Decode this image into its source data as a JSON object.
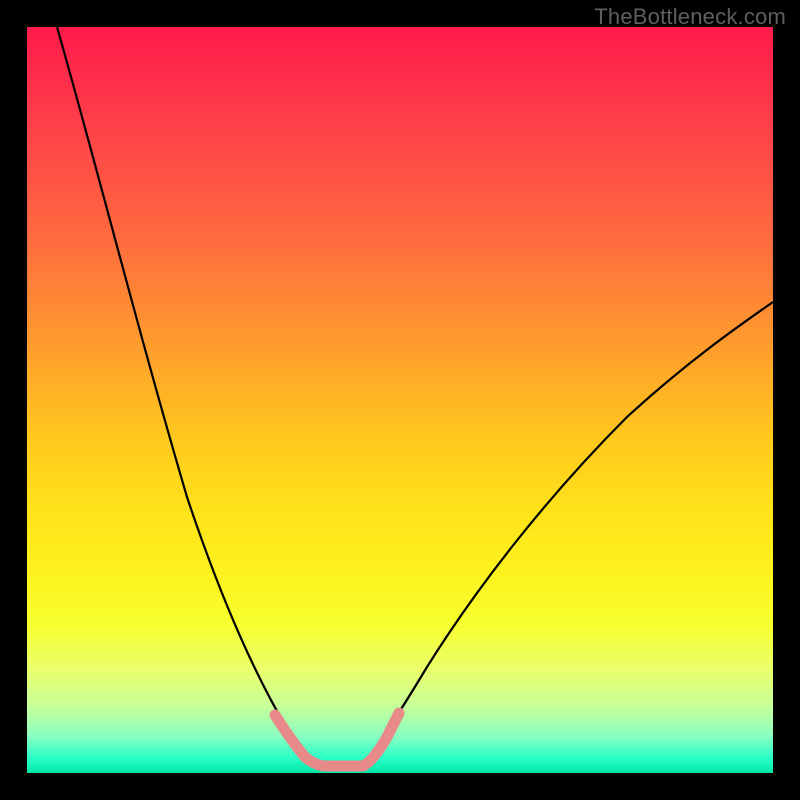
{
  "watermark": "TheBottleneck.com",
  "chart_data": {
    "type": "line",
    "title": "",
    "xlabel": "",
    "ylabel": "",
    "xlim": [
      0,
      100
    ],
    "ylim": [
      0,
      100
    ],
    "gradient_colors": {
      "top": "#ff1a4a",
      "mid": "#ffe31a",
      "bottom": "#00e6a8"
    },
    "series": [
      {
        "name": "left-curve",
        "x": [
          4,
          8,
          12,
          16,
          20,
          24,
          28,
          31,
          33,
          34.5,
          36,
          37.5
        ],
        "values": [
          100,
          79,
          61,
          46,
          33,
          22,
          13,
          7,
          4,
          2.5,
          1.5,
          1
        ]
      },
      {
        "name": "right-curve",
        "x": [
          44,
          46,
          48,
          52,
          56,
          62,
          70,
          78,
          86,
          94,
          100
        ],
        "values": [
          1,
          2,
          4,
          8,
          13,
          20,
          29,
          38,
          47,
          55,
          61
        ]
      },
      {
        "name": "floor-segment",
        "x": [
          37.5,
          44
        ],
        "values": [
          1,
          1
        ]
      },
      {
        "name": "pink-marker-left",
        "x": [
          32,
          33,
          34,
          35,
          36,
          37,
          38
        ],
        "values": [
          6.5,
          4.8,
          3.5,
          2.6,
          2.0,
          1.5,
          1.2
        ]
      },
      {
        "name": "pink-marker-floor",
        "x": [
          38,
          39,
          40,
          41,
          42,
          43,
          44
        ],
        "values": [
          1.0,
          1.0,
          1.0,
          1.0,
          1.0,
          1.0,
          1.0
        ]
      },
      {
        "name": "pink-marker-right",
        "x": [
          44,
          45,
          46,
          47,
          48
        ],
        "values": [
          1.2,
          2.0,
          3.2,
          4.8,
          6.5
        ]
      }
    ],
    "annotations": []
  }
}
